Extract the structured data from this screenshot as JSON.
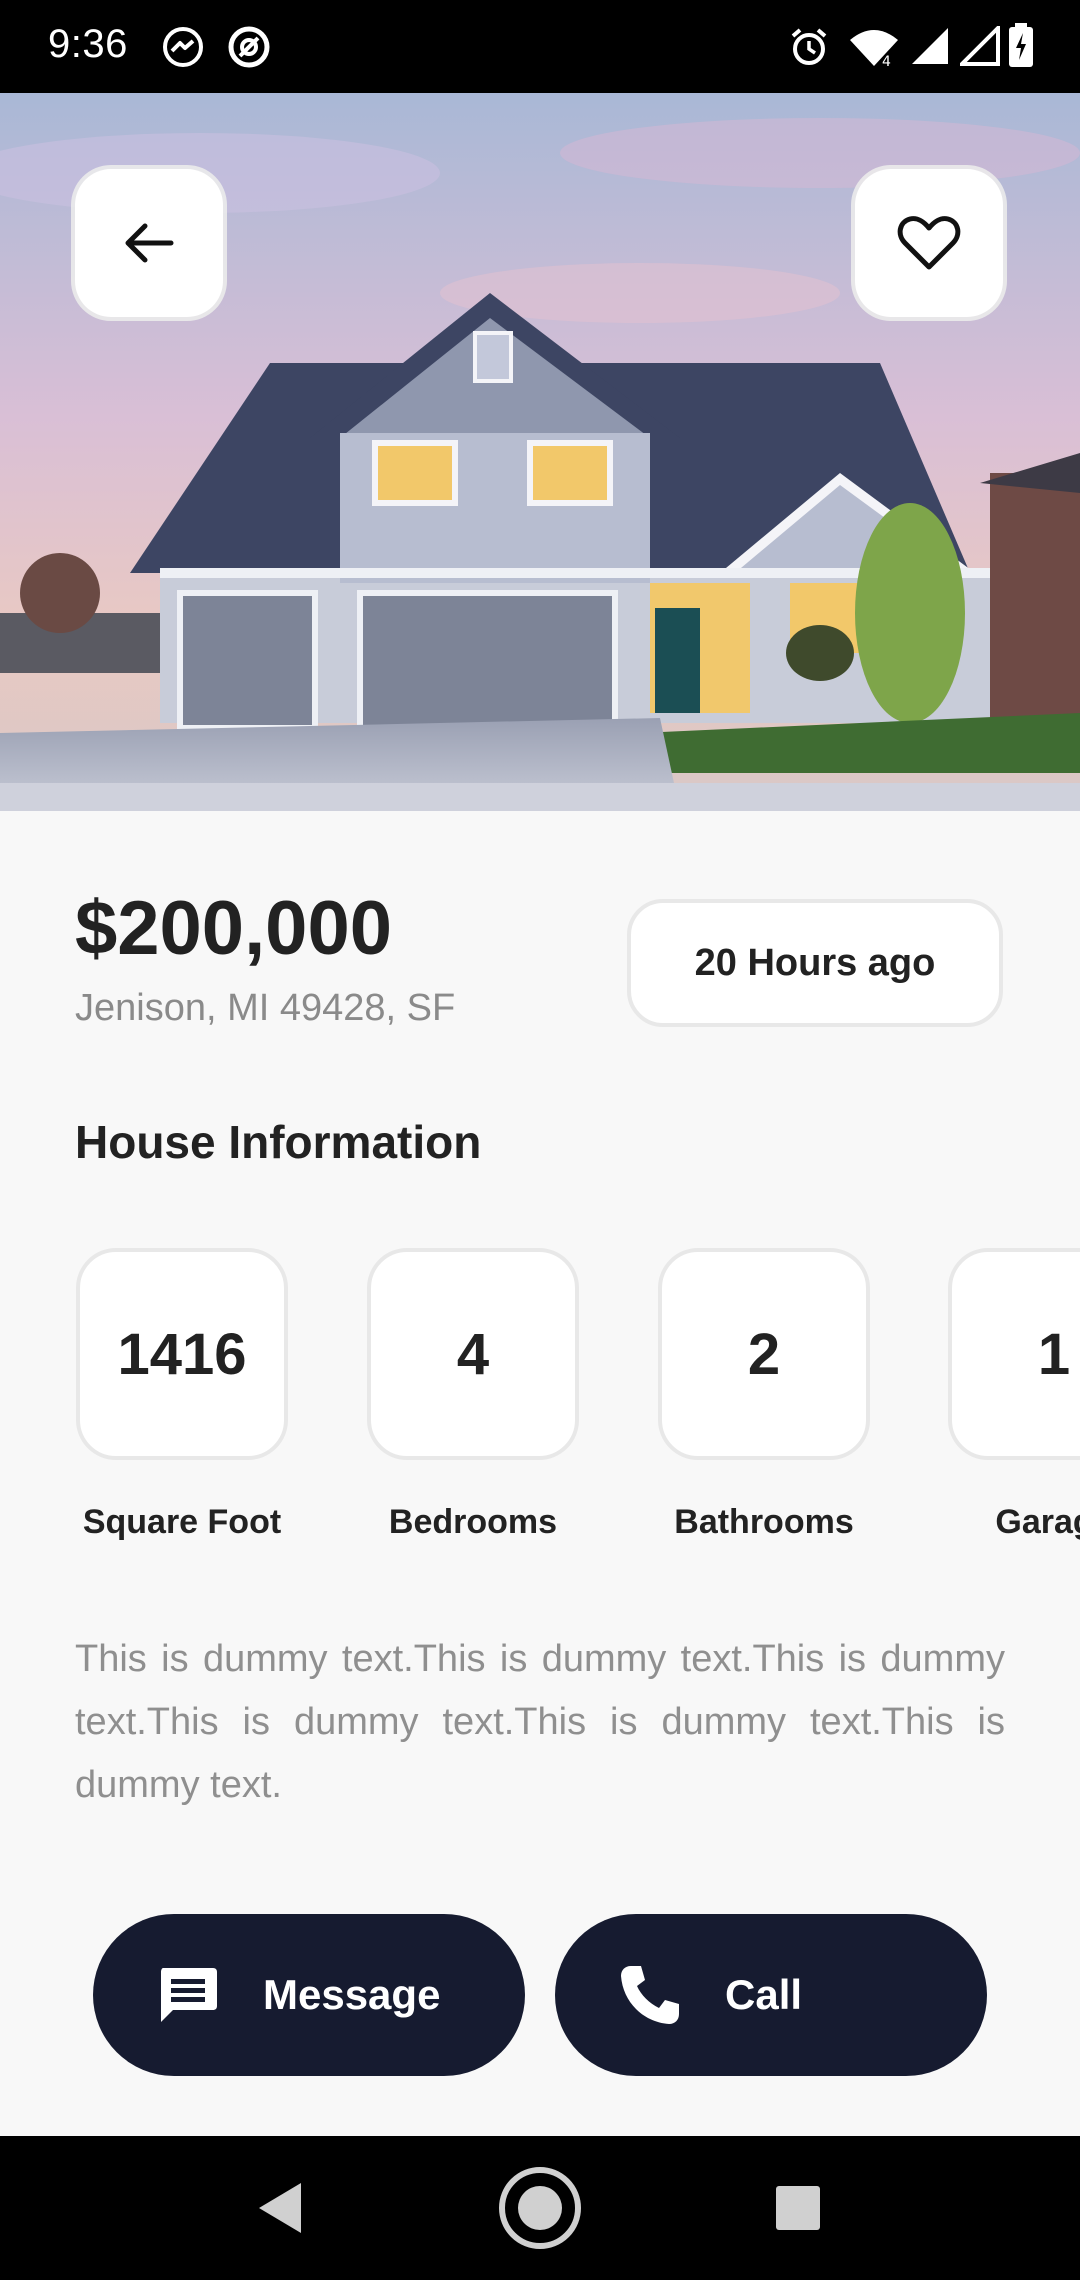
{
  "status_bar": {
    "time": "9:36",
    "left_icons": [
      "messenger-icon",
      "at-sign-icon"
    ],
    "right_icons": [
      "alarm-icon",
      "wifi-icon",
      "signal-icon",
      "signal-icon",
      "battery-charging-icon"
    ]
  },
  "header": {
    "back_icon": "arrow-left-icon",
    "favorite_icon": "heart-outline-icon"
  },
  "listing": {
    "price": "$200,000",
    "address": "Jenison, MI 49428, SF",
    "posted": "20 Hours ago",
    "section_title": "House Information",
    "info": [
      {
        "value": "1416",
        "label": "Square Foot"
      },
      {
        "value": "4",
        "label": "Bedrooms"
      },
      {
        "value": "2",
        "label": "Bathrooms"
      },
      {
        "value": "1",
        "label": "Garage"
      }
    ],
    "description": "This is dummy text.This is dummy text.This is dummy text.This is dummy text.This is dummy text.This is dummy text."
  },
  "actions": {
    "message_label": "Message",
    "call_label": "Call"
  },
  "colors": {
    "accent": "#161b30",
    "background": "#f8f8f8",
    "muted_text": "#8a8a8a"
  }
}
